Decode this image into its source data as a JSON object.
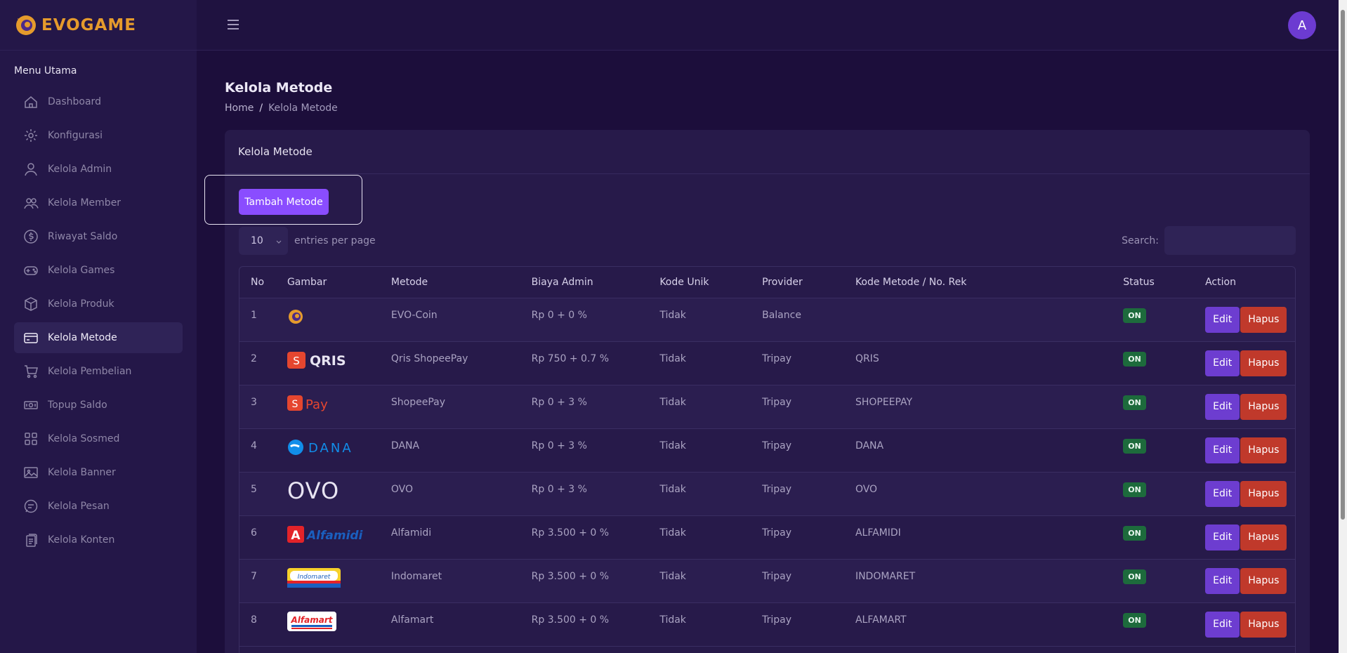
{
  "brand": {
    "name": "EVOGAME"
  },
  "sidebar": {
    "heading": "Menu Utama",
    "items": [
      {
        "label": "Dashboard",
        "icon": "home-icon"
      },
      {
        "label": "Konfigurasi",
        "icon": "gear-icon"
      },
      {
        "label": "Kelola Admin",
        "icon": "user-icon"
      },
      {
        "label": "Kelola Member",
        "icon": "users-icon"
      },
      {
        "label": "Riwayat Saldo",
        "icon": "dollar-circle-icon"
      },
      {
        "label": "Kelola Games",
        "icon": "gamepad-icon"
      },
      {
        "label": "Kelola Produk",
        "icon": "box-icon"
      },
      {
        "label": "Kelola Metode",
        "icon": "credit-card-icon",
        "active": true
      },
      {
        "label": "Kelola Pembelian",
        "icon": "cart-icon"
      },
      {
        "label": "Topup Saldo",
        "icon": "money-icon"
      },
      {
        "label": "Kelola Sosmed",
        "icon": "grid-icon"
      },
      {
        "label": "Kelola Banner",
        "icon": "image-icon"
      },
      {
        "label": "Kelola Pesan",
        "icon": "chat-icon"
      },
      {
        "label": "Kelola Konten",
        "icon": "document-icon"
      }
    ]
  },
  "topbar": {
    "avatar_initial": "A"
  },
  "page": {
    "title": "Kelola Metode",
    "breadcrumb": {
      "home": "Home",
      "separator": "/",
      "current": "Kelola Metode"
    }
  },
  "card": {
    "title": "Kelola Metode",
    "add_button": "Tambah Metode",
    "entries_value": "10",
    "entries_label": "entries per page",
    "search_label": "Search:",
    "search_value": ""
  },
  "table": {
    "headers": [
      "No",
      "Gambar",
      "Metode",
      "Biaya Admin",
      "Kode Unik",
      "Provider",
      "Kode Metode / No. Rek",
      "Status",
      "Action"
    ],
    "edit_label": "Edit",
    "delete_label": "Hapus",
    "rows": [
      {
        "no": "1",
        "logo": "evo-coin",
        "metode": "EVO-Coin",
        "biaya": "Rp 0 + 0 %",
        "kode_unik": "Tidak",
        "provider": "Balance",
        "kode": "",
        "status": "ON"
      },
      {
        "no": "2",
        "logo": "qris-shopeepay",
        "metode": "Qris ShopeePay",
        "biaya": "Rp 750 + 0.7 %",
        "kode_unik": "Tidak",
        "provider": "Tripay",
        "kode": "QRIS",
        "status": "ON"
      },
      {
        "no": "3",
        "logo": "shopeepay",
        "metode": "ShopeePay",
        "biaya": "Rp 0 + 3 %",
        "kode_unik": "Tidak",
        "provider": "Tripay",
        "kode": "SHOPEEPAY",
        "status": "ON"
      },
      {
        "no": "4",
        "logo": "dana",
        "metode": "DANA",
        "biaya": "Rp 0 + 3 %",
        "kode_unik": "Tidak",
        "provider": "Tripay",
        "kode": "DANA",
        "status": "ON"
      },
      {
        "no": "5",
        "logo": "ovo",
        "metode": "OVO",
        "biaya": "Rp 0 + 3 %",
        "kode_unik": "Tidak",
        "provider": "Tripay",
        "kode": "OVO",
        "status": "ON"
      },
      {
        "no": "6",
        "logo": "alfamidi",
        "metode": "Alfamidi",
        "biaya": "Rp 3.500 + 0 %",
        "kode_unik": "Tidak",
        "provider": "Tripay",
        "kode": "ALFAMIDI",
        "status": "ON"
      },
      {
        "no": "7",
        "logo": "indomaret",
        "metode": "Indomaret",
        "biaya": "Rp 3.500 + 0 %",
        "kode_unik": "Tidak",
        "provider": "Tripay",
        "kode": "INDOMARET",
        "status": "ON"
      },
      {
        "no": "8",
        "logo": "alfamart",
        "metode": "Alfamart",
        "biaya": "Rp 3.500 + 0 %",
        "kode_unik": "Tidak",
        "provider": "Tripay",
        "kode": "ALFAMART",
        "status": "ON"
      }
    ]
  },
  "logos": {
    "qris_text": "QRIS",
    "shopeepay_text": "Pay",
    "dana_text": "DANA",
    "ovo_text": "OVO",
    "alfamidi_text": "Alfamidi",
    "indomaret_text": "Indomaret",
    "alfamart_text": "Alfamart"
  },
  "colors": {
    "accent": "#8a4dff",
    "edit": "#6d3dd0",
    "delete": "#c0392b",
    "status_on": "#1d6b3c",
    "brand": "#e59b2c"
  }
}
